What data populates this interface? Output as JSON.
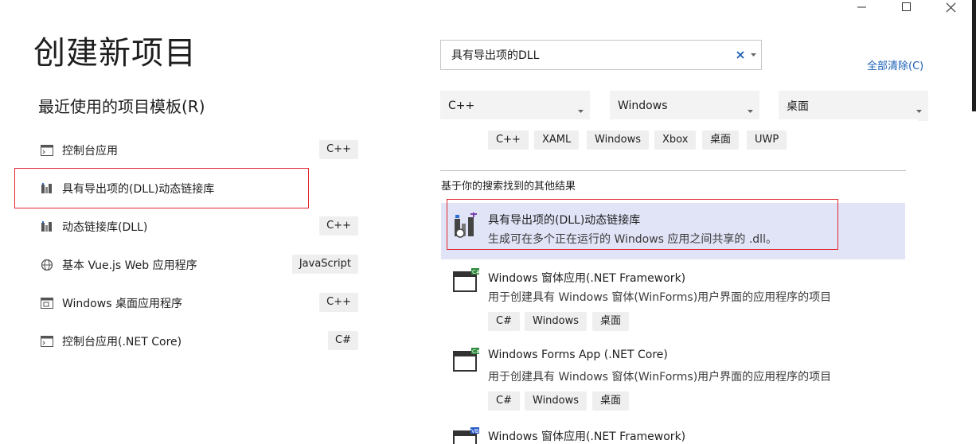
{
  "window": {
    "title": "创建新项目",
    "minimize_icon": "minimize-icon",
    "maximize_icon": "maximize-icon",
    "close_icon": "close-icon"
  },
  "recent": {
    "title": "最近使用的项目模板(R)",
    "items": [
      {
        "label": "控制台应用",
        "lang": "C++",
        "icon": "console-app-icon"
      },
      {
        "label": "具有导出项的(DLL)动态链接库",
        "lang": "",
        "icon": "dll-icon"
      },
      {
        "label": "动态链接库(DLL)",
        "lang": "C++",
        "icon": "dll-icon"
      },
      {
        "label": "基本 Vue.js Web 应用程序",
        "lang": "JavaScript",
        "icon": "web-globe-icon"
      },
      {
        "label": "Windows 桌面应用程序",
        "lang": "C++",
        "icon": "desktop-app-icon"
      },
      {
        "label": "控制台应用(.NET Core)",
        "lang": "C#",
        "icon": "console-app-icon"
      }
    ]
  },
  "search": {
    "value": "具有导出项的DLL",
    "clear_all": "全部清除(C)"
  },
  "filters": {
    "language": "C++",
    "platform": "Windows",
    "project_type": "桌面"
  },
  "top_tags": [
    "C++",
    "XAML",
    "Windows",
    "Xbox",
    "桌面",
    "UWP"
  ],
  "other_results_label": "基于你的搜索找到的其他结果",
  "results": [
    {
      "name": "具有导出项的(DLL)动态链接库",
      "desc": "生成可在多个正在运行的 Windows 应用之间共享的 .dll。",
      "tags": [],
      "icon": "dll-export-icon"
    },
    {
      "name": "Windows 窗体应用(.NET Framework)",
      "desc": "用于创建具有 Windows 窗体(WinForms)用户界面的应用程序的项目",
      "tags": [
        "C#",
        "Windows",
        "桌面"
      ],
      "icon": "winforms-csharp-icon"
    },
    {
      "name": "Windows Forms App (.NET Core)",
      "desc": "用于创建具有 Windows 窗体(WinForms)用户界面的应用程序的项目",
      "tags": [
        "C#",
        "Windows",
        "桌面"
      ],
      "icon": "winforms-csharp-icon"
    },
    {
      "name": "Windows 窗体应用(.NET Framework)",
      "desc": "",
      "tags": [],
      "icon": "winforms-vb-icon"
    }
  ],
  "colors": {
    "accent": "#1a5fb4",
    "selected_bg": "#e1e3f7",
    "highlight_box": "#e0242f",
    "tag_bg": "#efefef"
  }
}
